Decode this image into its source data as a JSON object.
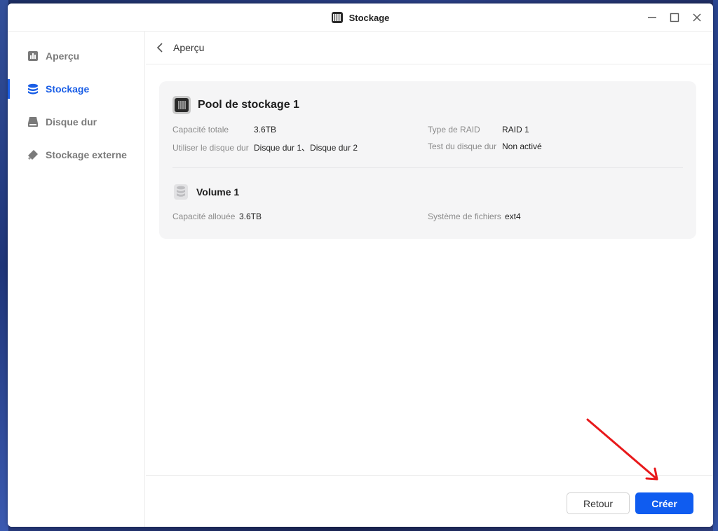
{
  "window": {
    "title": "Stockage"
  },
  "sidebar": {
    "items": [
      {
        "label": "Aperçu",
        "icon": "chart-icon",
        "active": false
      },
      {
        "label": "Stockage",
        "icon": "database-icon",
        "active": true
      },
      {
        "label": "Disque dur",
        "icon": "hard-drive-icon",
        "active": false
      },
      {
        "label": "Stockage externe",
        "icon": "usb-drive-icon",
        "active": false
      }
    ]
  },
  "header": {
    "title": "Aperçu"
  },
  "pool": {
    "title": "Pool de stockage 1",
    "capacity_label": "Capacité totale",
    "capacity_value": "3.6TB",
    "disks_label": "Utiliser le disque dur",
    "disks_value": "Disque dur 1、Disque dur 2",
    "raid_label": "Type de RAID",
    "raid_value": "RAID 1",
    "test_label": "Test du disque dur",
    "test_value": "Non activé"
  },
  "volume": {
    "title": "Volume 1",
    "allocated_label": "Capacité allouée",
    "allocated_value": "3.6TB",
    "fs_label": "Système de fichiers",
    "fs_value": "ext4"
  },
  "footer": {
    "back_label": "Retour",
    "create_label": "Créer"
  },
  "colors": {
    "accent": "#1a5ee6",
    "primary_button": "#0f5cf0",
    "annotation_arrow": "#e8191b"
  }
}
